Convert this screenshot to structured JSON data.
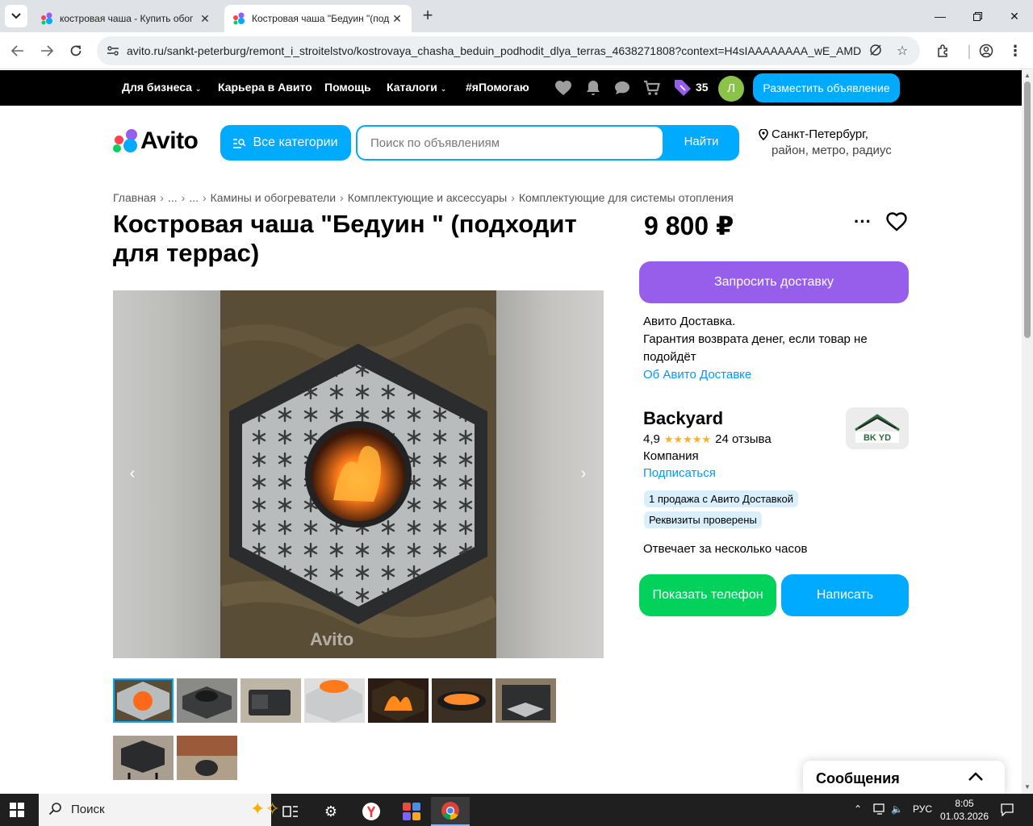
{
  "browser": {
    "tabs": [
      {
        "title": "костровая чаша - Купить обог",
        "active": false
      },
      {
        "title": "Костровая чаша \"Бедуин \"(под",
        "active": true
      }
    ],
    "url": "avito.ru/sankt-peterburg/remont_i_stroitelstvo/kostrovaya_chasha_beduin_podhodit_dlya_terras_4638271808?context=H4sIAAAAAAAA_wE_AMD...",
    "new_tab_symbol": "+"
  },
  "topbar": {
    "links": [
      "Для бизнеса",
      "Карьера в Авито",
      "Помощь",
      "Каталоги",
      "#яПомогаю"
    ],
    "wallet_count": "35",
    "avatar_letter": "Л",
    "post_button": "Разместить объявление"
  },
  "header": {
    "logo_text": "Avito",
    "categories_button": "Все категории",
    "search_placeholder": "Поиск по объявлениям",
    "search_button": "Найти",
    "location_city": "Санкт-Петербург,",
    "location_sub": "район, метро, радиус"
  },
  "breadcrumbs": [
    "Главная",
    "...",
    "...",
    "Камины и обогреватели",
    "Комплектующие и аксессуары",
    "Комплектующие для системы отопления"
  ],
  "listing": {
    "title": "Костровая чаша \"Бедуин \" (подходит для террас)",
    "price": "9 800 ₽",
    "photo_count": 9,
    "selected_photo": 1,
    "watermark": "Avito"
  },
  "delivery": {
    "button": "Запросить доставку",
    "line1": "Авито Доставка.",
    "line2": "Гарантия возврата денег, если товар не подойдёт",
    "link": "Об Авито Доставке"
  },
  "seller": {
    "name": "Backyard",
    "rating": "4,9",
    "stars": 5,
    "reviews": "24 отзыва",
    "type": "Компания",
    "subscribe": "Подписаться",
    "logo_text": "BK YD",
    "badges": [
      "1 продажа с Авито Доставкой",
      "Реквизиты проверены"
    ],
    "response_time": "Отвечает за несколько часов"
  },
  "actions": {
    "show_phone": "Показать телефон",
    "write": "Написать"
  },
  "messages_panel": {
    "label": "Сообщения"
  },
  "taskbar": {
    "search_label": "Поиск",
    "lang": "РУС",
    "time": "8:05",
    "date": "01.03.2026"
  },
  "colors": {
    "accent_blue": "#00aaff",
    "delivery_purple": "#965eeb",
    "phone_green": "#02d15c",
    "link_blue": "#0099f7"
  }
}
